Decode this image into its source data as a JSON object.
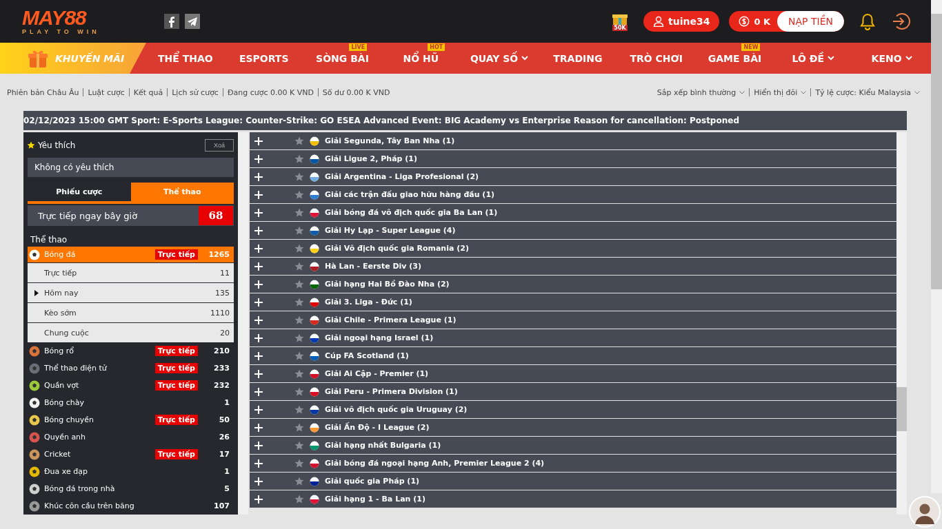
{
  "header": {
    "logo": {
      "brand": "MAY88",
      "tagline": "PLAY TO WIN"
    },
    "gift_badge": "50K",
    "user": "tuine34",
    "balance": "0 K",
    "deposit": "NẠP TIỀN"
  },
  "nav": [
    {
      "label": "KHUYẾN MÃI",
      "kind": "promo",
      "dropdown": false
    },
    {
      "label": "THỂ THAO",
      "kind": "link",
      "dropdown": false
    },
    {
      "label": "ESPORTS",
      "kind": "link",
      "dropdown": false
    },
    {
      "label": "SÒNG BÀI",
      "kind": "link",
      "badge": "LIVE",
      "dropdown": false
    },
    {
      "label": "NỔ HŨ",
      "kind": "link",
      "badge": "HOT",
      "dropdown": false
    },
    {
      "label": "QUAY SỐ",
      "kind": "link",
      "dropdown": true
    },
    {
      "label": "TRADING",
      "kind": "link",
      "dropdown": false
    },
    {
      "label": "TRÒ CHƠI",
      "kind": "link",
      "dropdown": false
    },
    {
      "label": "GAME BÀI",
      "kind": "link",
      "badge": "NEW",
      "dropdown": false
    },
    {
      "label": "LÔ ĐỀ",
      "kind": "link",
      "dropdown": true
    },
    {
      "label": "KENO",
      "kind": "link",
      "dropdown": true
    }
  ],
  "info_links": [
    "Phiên bản Châu Âu",
    "Luật cược",
    "Kết quả",
    "Lịch sử cược",
    "Đang cược 0.00 K VND",
    "Số dư 0.00 K VND"
  ],
  "options": [
    "Sắp xếp bình thường",
    "Hiển thị đôi",
    "Tỷ lệ cược: Kiểu Malaysia"
  ],
  "ticker": "02/12/2023 15:00 GMT Sport: E-Sports League: Counter-Strike: GO ESEA Advanced Event: BIG Academy vs Enterprise Reason for cancellation: Postponed",
  "sidebar": {
    "favorites": {
      "title": "Yêu thích",
      "clear": "Xoá",
      "empty": "Không có yêu thích"
    },
    "tabs": [
      {
        "label": "Phiếu cược",
        "selected": false
      },
      {
        "label": "Thể thao",
        "selected": true
      }
    ],
    "live_now": {
      "label": "Trực tiếp ngay bây giờ",
      "count": "68"
    },
    "sports_title": "Thể thao",
    "sports": [
      {
        "name": "Bóng đá",
        "color": "#ffffff",
        "badge": "Trực tiếp",
        "count": "1265",
        "selected": true,
        "children": [
          {
            "name": "Trực tiếp",
            "count": "11",
            "kind": "leaf"
          },
          {
            "name": "Hôm nay",
            "count": "135",
            "kind": "group"
          },
          {
            "name": "Kèo sớm",
            "count": "1110",
            "kind": "leaf"
          },
          {
            "name": "Chung cuộc",
            "count": "20",
            "kind": "leaf"
          }
        ]
      },
      {
        "name": "Bóng rổ",
        "color": "#d9733a",
        "badge": "Trực tiếp",
        "count": "210",
        "selected": false
      },
      {
        "name": "Thể thao điện tử",
        "color": "#6b6e75",
        "badge": "Trực tiếp",
        "count": "233",
        "selected": false
      },
      {
        "name": "Quần vợt",
        "color": "#9bc93a",
        "badge": "Trực tiếp",
        "count": "232",
        "selected": false
      },
      {
        "name": "Bóng chày",
        "color": "#f2f2f2",
        "count": "1",
        "selected": false
      },
      {
        "name": "Bóng chuyền",
        "color": "#e8c84a",
        "badge": "Trực tiếp",
        "count": "50",
        "selected": false
      },
      {
        "name": "Quyền anh",
        "color": "#d9534f",
        "count": "26",
        "selected": false
      },
      {
        "name": "Cricket",
        "color": "#c8955a",
        "badge": "Trực tiếp",
        "count": "17",
        "selected": false
      },
      {
        "name": "Đua xe đạp",
        "color": "#e6b800",
        "count": "1",
        "selected": false
      },
      {
        "name": "Bóng đá trong nhà",
        "color": "#cfcfcf",
        "count": "5",
        "selected": false
      },
      {
        "name": "Khúc côn cầu trên băng",
        "color": "#9a9a9a",
        "count": "107",
        "selected": false
      }
    ]
  },
  "leagues": [
    {
      "name": "Giải Segunda, Tây Ban Nha (1)",
      "color": "#f1bf00"
    },
    {
      "name": "Giải Ligue 2, Pháp (1)",
      "color": "#0055a4"
    },
    {
      "name": "Giải Argentina - Liga Profesional (2)",
      "color": "#74acdf"
    },
    {
      "name": "Giải các trận đấu giao hữu hàng đầu (1)",
      "color": "#2f7fd1"
    },
    {
      "name": "Giải bóng đá vô địch quốc gia Ba Lan (1)",
      "color": "#dc143c"
    },
    {
      "name": "Giải Hy Lạp - Super League (4)",
      "color": "#0d5eaf"
    },
    {
      "name": "Giải Vô địch quốc gia Romania (2)",
      "color": "#fcd116"
    },
    {
      "name": "Hà Lan - Eerste Div (3)",
      "color": "#ae1c28"
    },
    {
      "name": "Giải hạng Hai Bồ Đào Nha (2)",
      "color": "#006600"
    },
    {
      "name": "Giải 3. Liga - Đức (1)",
      "color": "#dd0000"
    },
    {
      "name": "Giải Chile - Primera League (1)",
      "color": "#d52b1e"
    },
    {
      "name": "Giải ngoại hạng Israel (1)",
      "color": "#0038b8"
    },
    {
      "name": "Cúp FA Scotland (1)",
      "color": "#005eb8"
    },
    {
      "name": "Giải Ai Cập - Premier (1)",
      "color": "#ce1126"
    },
    {
      "name": "Giải Peru - Primera Division (1)",
      "color": "#d91023"
    },
    {
      "name": "Giải vô địch quốc gia Uruguay (2)",
      "color": "#0038a8"
    },
    {
      "name": "Giải Ấn Độ - I League (2)",
      "color": "#ff9933"
    },
    {
      "name": "Giải hạng nhất Bulgaria (1)",
      "color": "#00966e"
    },
    {
      "name": "Giải bóng đá ngoại hạng Anh, Premier League 2 (4)",
      "color": "#cf142b"
    },
    {
      "name": "Giải quốc gia Pháp (1)",
      "color": "#002395"
    },
    {
      "name": "Giải hạng 1 - Ba Lan (1)",
      "color": "#dc143c"
    }
  ]
}
